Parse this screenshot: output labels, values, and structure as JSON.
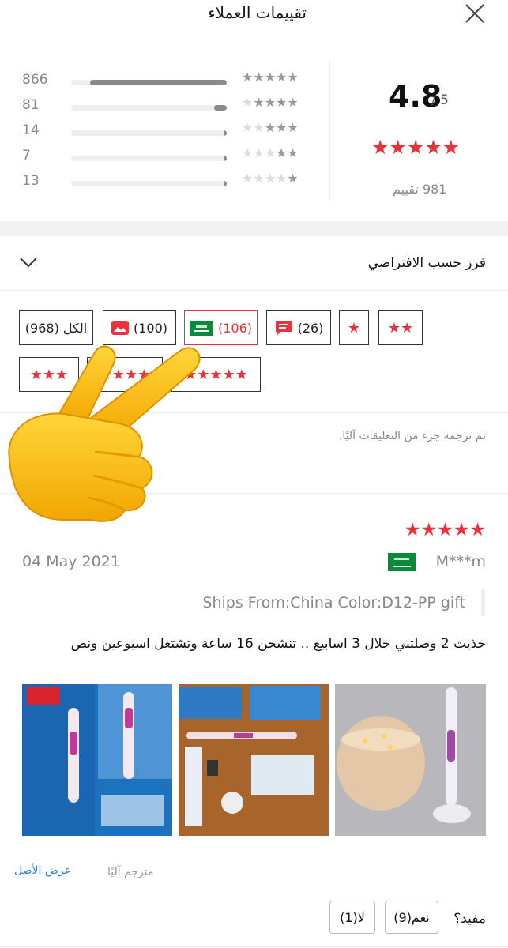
{
  "header": {
    "title": "تقييمات العملاء"
  },
  "summary": {
    "score": "4.8",
    "out_of": "/ 5",
    "stars": "★★★★★",
    "count_label": "981 تقييم",
    "distribution": [
      {
        "count": "866",
        "fraction": 0.88,
        "stars": 5
      },
      {
        "count": "81",
        "fraction": 0.08,
        "stars": 4
      },
      {
        "count": "14",
        "fraction": 0.02,
        "stars": 3
      },
      {
        "count": "7",
        "fraction": 0.01,
        "stars": 2
      },
      {
        "count": "13",
        "fraction": 0.02,
        "stars": 1
      }
    ]
  },
  "sort": {
    "label": "فرز حسب الافتراضي"
  },
  "filters": {
    "all": "الكل (968)",
    "photos": "(100)",
    "country": "(106)",
    "comments": "(26)",
    "one_star": "★",
    "two_star": "★★",
    "three_star": "★★★",
    "four_star": "★★★★",
    "five_star": "★★★★★"
  },
  "note": "تم ترجمة جزء من التعليقات آليًا.",
  "review": {
    "stars": "★★★★★",
    "date": "04 May 2021",
    "name": "M***m",
    "specs": "Ships From:China Color:D12-PP gift",
    "text": "خذيت 2 وصلتني خلال 3 اسابيع .. تنشحن 16 ساعة وتشتغل اسبوعين ونص",
    "show_original": "عرض الأصل",
    "translated": "مترجم آليًا",
    "helpful_label": "مفيد؟",
    "yes": "نعم(9)",
    "no": "لا(1)"
  },
  "colors": {
    "accent": "#e8323c",
    "link": "#2f7fd6",
    "emoji": "#f6b400"
  },
  "icons": [
    "close-icon",
    "chevron-down-icon",
    "image-icon",
    "comment-icon",
    "saudi-flag-icon",
    "pointing-hand-emoji"
  ]
}
